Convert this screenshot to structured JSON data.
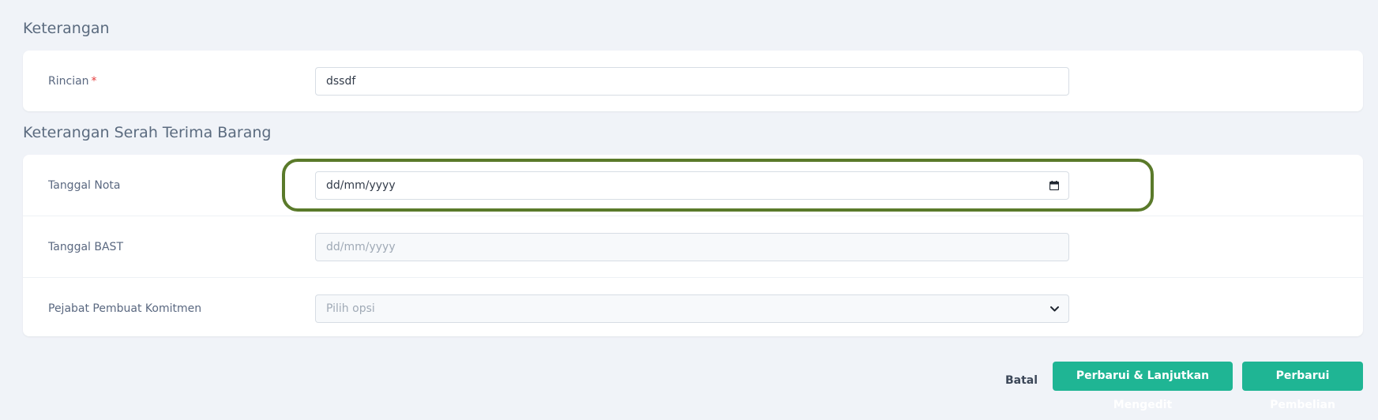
{
  "sections": {
    "keterangan": {
      "title": "Keterangan",
      "rincian_label": "Rincian",
      "required_mark": "*",
      "rincian_value": "dssdf"
    },
    "serah_terima": {
      "title": "Keterangan Serah Terima Barang",
      "tanggal_nota_label": "Tanggal Nota",
      "tanggal_nota_value": "dd/mm/yyyy",
      "tanggal_bast_label": "Tanggal BAST",
      "tanggal_bast_placeholder": "dd/mm/yyyy",
      "pejabat_label": "Pejabat Pembuat Komitmen",
      "pejabat_placeholder": "Pilih opsi"
    }
  },
  "actions": {
    "cancel": "Batal",
    "update_continue": "Perbarui & Lanjutkan Mengedit",
    "update": "Perbarui Pembelian"
  },
  "colors": {
    "primary": "#1fb594",
    "highlight": "#5a7a2a",
    "required": "#e53e3e"
  }
}
